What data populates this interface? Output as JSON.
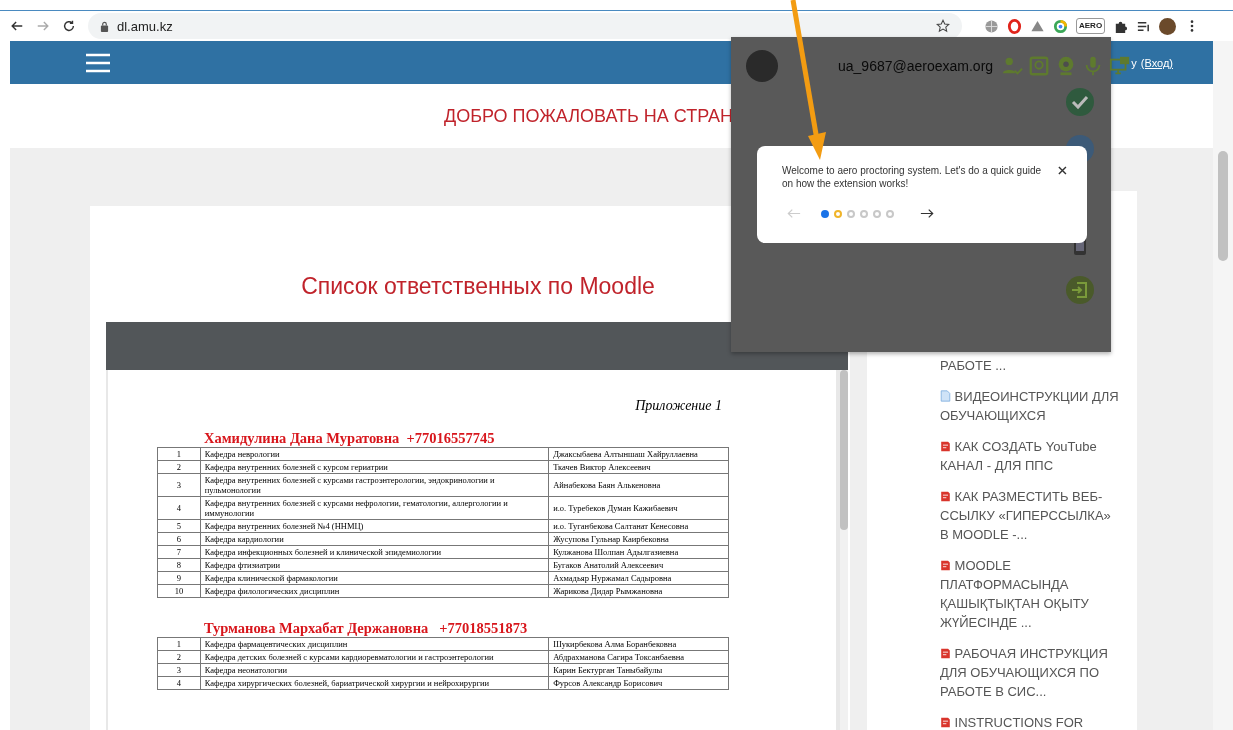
{
  "browser": {
    "url": "dl.amu.kz",
    "extension_badge": "AERO"
  },
  "site_header": {
    "login_prefix": "у",
    "login_link": "(Вход)"
  },
  "banner": {
    "text": "ДОБРО ПОЖАЛОВАТЬ НА СТРАН"
  },
  "main": {
    "title": "Список ответственных по Moodle",
    "document": {
      "appendix": "Приложение 1",
      "sections": [
        {
          "heading": "Хамидулина Дана Муратовна  +77016557745",
          "rows": [
            {
              "number": "1",
              "department": "Кафедра неврологии",
              "responsible": "Джаксыбаева Алтыншаш Хайруллаевна"
            },
            {
              "number": "2",
              "department": "Кафедра внутренних болезней с курсом гериатрии",
              "responsible": "Ткачев Виктор Алексеевич"
            },
            {
              "number": "3",
              "department": "Кафедра внутренних болезней  с курсами  гастроэнтерологии, эндокринологии и пульмонологии",
              "responsible": "Айнабекова Баян Алькеновна"
            },
            {
              "number": "4",
              "department": "Кафедра внутренних болезней с курсами нефрологии, гематологии, аллергологии и иммунологии",
              "responsible": "и.о. Туребеков Думан Кажибаевич"
            },
            {
              "number": "5",
              "department": "Кафедра внутренних болезней №4 (ННМЦ)",
              "responsible": "и.о. Туганбекова Салтанат Кенесовна"
            },
            {
              "number": "6",
              "department": "Кафедра кардиологии",
              "responsible": "Жусупова Гульнар Каирбековна"
            },
            {
              "number": "7",
              "department": "Кафедра инфекционных болезней и клинической эпидемиологии",
              "responsible": "Кулжанова Шолпан Адылгазиевна"
            },
            {
              "number": "8",
              "department": "Кафедра фтизиатрии",
              "responsible": "Бугаков Анатолий Алексеевич"
            },
            {
              "number": "9",
              "department": "Кафедра клинической фармакологии",
              "responsible": "Ахмадьяр Нуржамал Садыровна"
            },
            {
              "number": "10",
              "department": "Кафедра филологических дисциплин",
              "responsible": "Жарикова Дидар Рымжановна"
            }
          ]
        },
        {
          "heading": "Турманова Мархабат Держановна   +77018551873",
          "rows": [
            {
              "number": "1",
              "department": "Кафедра фармацевтических дисциплин",
              "responsible": "Шукирбекова Алма Боранбековна"
            },
            {
              "number": "2",
              "department": "Кафедра детских болезней с курсами кардиоревматологии и гастроэнтерологии",
              "responsible": "Абдрахманова Сагира Токсанбаевна"
            },
            {
              "number": "3",
              "department": "Кафедра неонатологии",
              "responsible": "Карин Бектурган Таныбайулы"
            },
            {
              "number": "4",
              "department": "Кафедра хирургических болезней, бариатрической хирургии и нейрохирургии",
              "responsible": "Фурсов Александр Борисович"
            }
          ]
        }
      ]
    }
  },
  "sidebar": {
    "items": [
      {
        "kind": "none",
        "label": "РАБОТЕ ..."
      },
      {
        "kind": "file",
        "label": "ВИДЕОИНСТРУКЦИИ ДЛЯ ОБУЧАЮЩИХСЯ"
      },
      {
        "kind": "pdf",
        "label": "КАК СОЗДАТЬ YouTube КАНАЛ - ДЛЯ ППС"
      },
      {
        "kind": "pdf",
        "label": "КАК РАЗМЕСТИТЬ ВЕБ-ССЫЛКУ «ГИПЕРССЫЛКА» В MOODLE -..."
      },
      {
        "kind": "pdf",
        "label": "MOODLE ПЛАТФОРМАСЫНДА ҚАШЫҚТЫҚТАН ОҚЫТУ ЖҮЙЕСІНДЕ ..."
      },
      {
        "kind": "pdf",
        "label": "РАБОЧАЯ ИНСТРУКЦИЯ ДЛЯ ОБУЧАЮЩИХСЯ ПО РАБОТЕ В СИС..."
      },
      {
        "kind": "pdf",
        "label": "INSTRUCTIONS FOR"
      }
    ]
  },
  "extension_popup": {
    "email": "ua_9687@aeroexam.org",
    "tour": {
      "text": "Welcome to aero proctoring system. Let's do a quick guide on how the extension works!",
      "steps": [
        {
          "selected": true,
          "color": "#1a73e8"
        },
        {
          "selected": false,
          "color": "#f0b429"
        },
        {
          "selected": false,
          "color": "#c8c8c8"
        },
        {
          "selected": false,
          "color": "#c8c8c8"
        },
        {
          "selected": false,
          "color": "#c8c8c8"
        },
        {
          "selected": false,
          "color": "#c8c8c8"
        }
      ]
    }
  }
}
